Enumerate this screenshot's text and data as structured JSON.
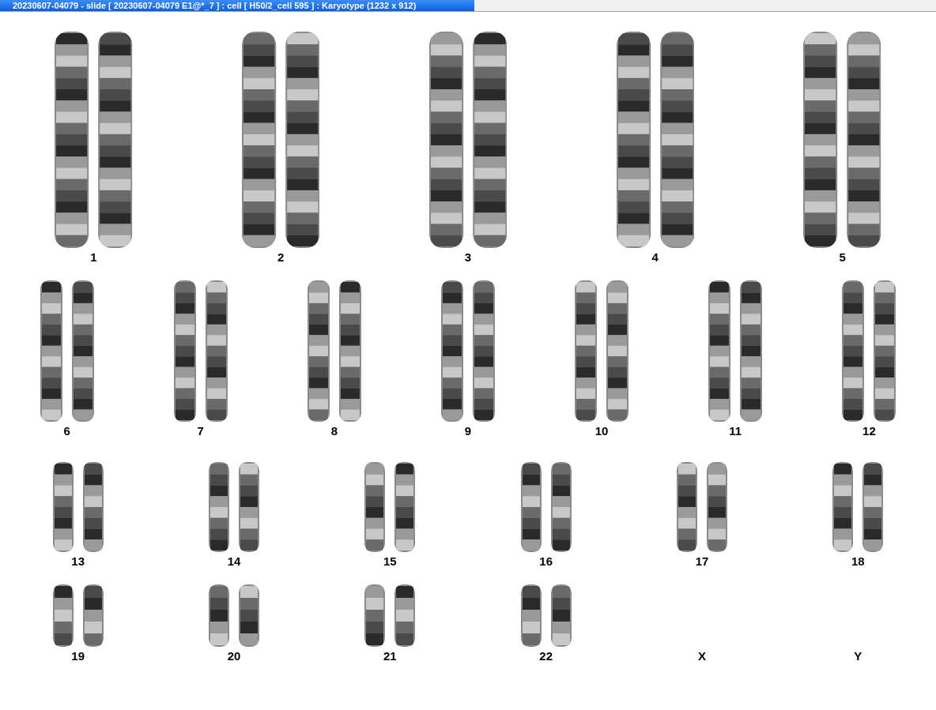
{
  "window": {
    "title": "20230607-04079 - slide [ 20230607-04079 E1@*_7 ] : cell [ H50/2_cell 595 ] : Karyotype  (1232 x 912)"
  },
  "karyotype": {
    "rows": [
      {
        "groups": [
          {
            "label": "1",
            "kind": "pair"
          },
          {
            "label": "2",
            "kind": "pair"
          },
          {
            "label": "3",
            "kind": "pair"
          },
          {
            "label": "4",
            "kind": "pair"
          },
          {
            "label": "5",
            "kind": "pair"
          }
        ]
      },
      {
        "groups": [
          {
            "label": "6",
            "kind": "pair"
          },
          {
            "label": "7",
            "kind": "pair"
          },
          {
            "label": "8",
            "kind": "pair"
          },
          {
            "label": "9",
            "kind": "pair"
          },
          {
            "label": "10",
            "kind": "pair"
          },
          {
            "label": "11",
            "kind": "pair"
          },
          {
            "label": "12",
            "kind": "pair"
          }
        ]
      },
      {
        "groups": [
          {
            "label": "13",
            "kind": "pair"
          },
          {
            "label": "14",
            "kind": "pair"
          },
          {
            "label": "15",
            "kind": "pair"
          },
          {
            "label": "16",
            "kind": "pair"
          },
          {
            "label": "17",
            "kind": "pair"
          },
          {
            "label": "18",
            "kind": "pair"
          }
        ]
      },
      {
        "groups": [
          {
            "label": "19",
            "kind": "pair"
          },
          {
            "label": "20",
            "kind": "pair"
          },
          {
            "label": "21",
            "kind": "pair"
          },
          {
            "label": "22",
            "kind": "pair"
          },
          {
            "label": "X",
            "kind": "empty"
          },
          {
            "label": "Y",
            "kind": "empty"
          }
        ]
      }
    ]
  }
}
